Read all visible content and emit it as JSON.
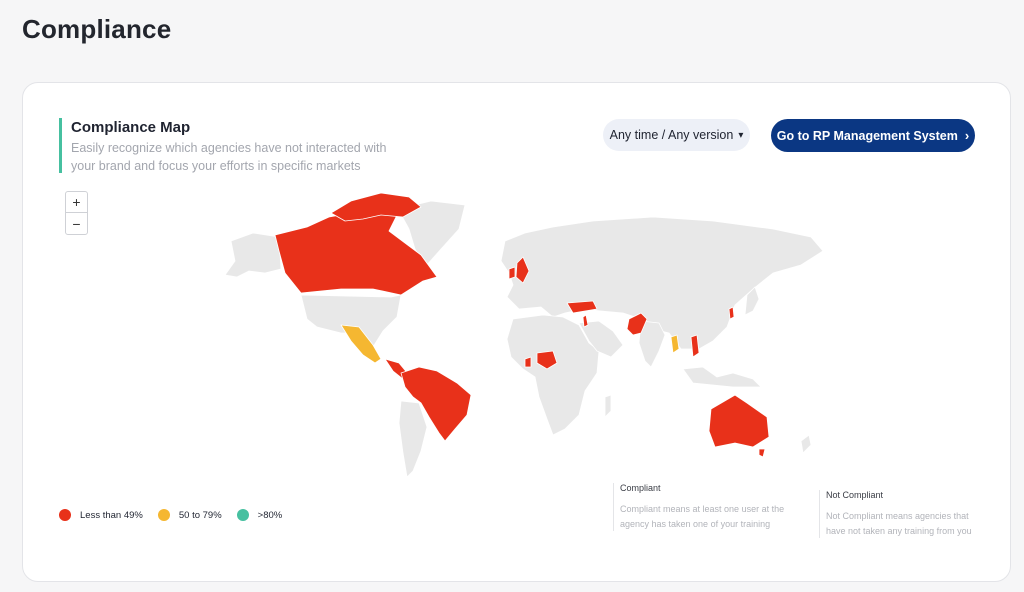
{
  "page": {
    "title": "Compliance"
  },
  "compliance_map": {
    "title": "Compliance Map",
    "subtitle": "Easily recognize which agencies have not interacted with your brand and focus your efforts in specific markets"
  },
  "filter": {
    "label": "Any time / Any version"
  },
  "rp_button": {
    "label": "Go to RP Management System"
  },
  "zoom": {
    "in": "+",
    "out": "−"
  },
  "colors": {
    "less_than_49": "#e8311a",
    "from_50_to_79": "#f5b731",
    "above_80": "#46c0a0",
    "neutral": "#e8e8e8",
    "accent": "#0b3783"
  },
  "map": {
    "highlighted": {
      "red": [
        "Canada",
        "Central America",
        "Colombia",
        "Venezuela",
        "Brazil",
        "United Kingdom",
        "Ireland",
        "Turkey",
        "Israel",
        "Pakistan",
        "Nigeria",
        "Ghana",
        "South Korea",
        "Vietnam",
        "Australia"
      ],
      "yellow": [
        "Mexico",
        "Myanmar"
      ]
    }
  },
  "legend": [
    {
      "label": "Less than 49%",
      "color": "#e8311a"
    },
    {
      "label": "50 to 79%",
      "color": "#f5b731"
    },
    {
      "label": ">80%",
      "color": "#46c0a0"
    }
  ],
  "info": {
    "compliant_title": "Compliant",
    "compliant_text": "Compliant means at least one user at the agency has taken one of your training",
    "not_compliant_title": "Not Compliant",
    "not_compliant_text": "Not Compliant means agencies that have not taken any training from you"
  }
}
